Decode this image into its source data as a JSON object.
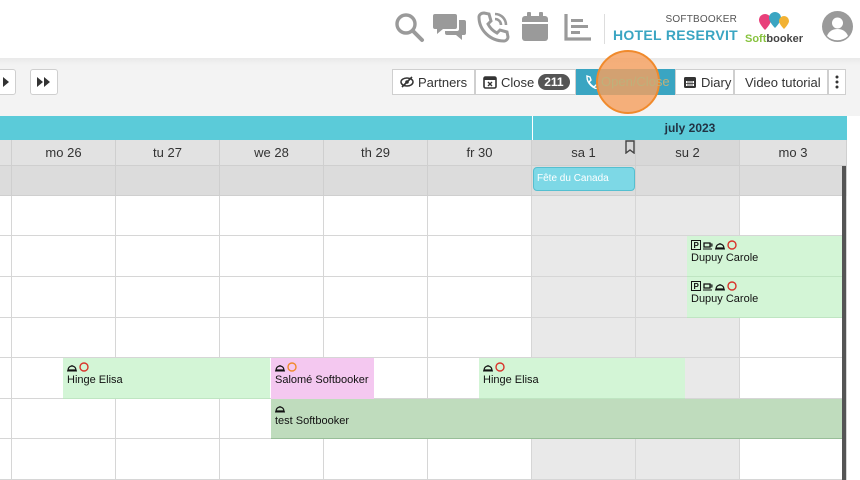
{
  "header": {
    "icons": [
      "search-icon",
      "chat-icon",
      "phone-icon",
      "calendar-icon",
      "reports-icon"
    ],
    "brand_small": "SOFTBOOKER",
    "brand_name": "HOTEL RESERVIT",
    "logo_text_a": "Soft",
    "logo_text_b": "booker",
    "colors": {
      "brand": "#3aa5c2",
      "logo_green": "#88c33f"
    }
  },
  "toolbar": {
    "partners_label": "Partners",
    "close_label": "Close",
    "close_count": "211",
    "openclose_label": "Open/Close",
    "diary_label": "Diary",
    "video_label": "Video tutorial"
  },
  "calendar": {
    "month": "july 2023",
    "days": [
      "mo 26",
      "tu 27",
      "we 28",
      "th 29",
      "fr 30",
      "sa 1",
      "su 2",
      "mo 3"
    ],
    "holiday": "Fête du Canada",
    "colors": {
      "month_band": "#5bcbd9",
      "booking_green": "#d3f5d6",
      "booking_pink": "#f4c8f0",
      "booking_dark": "#bfdcbd"
    }
  },
  "bookings": [
    {
      "guest": "Dupuy Carole"
    },
    {
      "guest": "Dupuy Carole"
    },
    {
      "guest": "Hinge Elisa"
    },
    {
      "guest": "Salomé Softbooker"
    },
    {
      "guest": "Hinge Elisa"
    },
    {
      "guest": "test Softbooker"
    }
  ]
}
